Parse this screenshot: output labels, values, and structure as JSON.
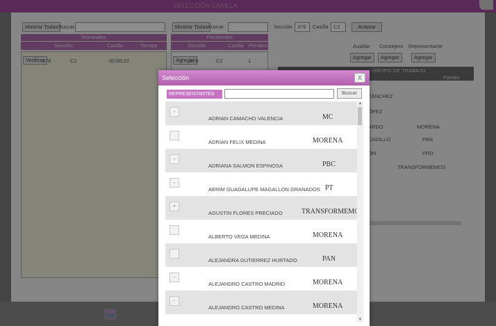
{
  "top": {
    "title": "SELECCIÓN CASILLA"
  },
  "left_panel": {
    "show_all": "Mostrar Todas",
    "search_label": "Buscar",
    "header": "Nominales",
    "columns": [
      "Sección",
      "Casilla",
      "Tiempo"
    ],
    "row": {
      "action": "Verificar",
      "seccion": "376",
      "casilla": "C2",
      "tiempo": "00:00:22"
    }
  },
  "mid_panel": {
    "show_all": "Mostrar Todas",
    "search_label": "Buscar",
    "header": "Pendientes",
    "columns": [
      "Sección",
      "Casilla",
      "Pendiente"
    ],
    "row": {
      "action": "Agregar",
      "seccion": "376",
      "casilla": "C2",
      "value": "1"
    }
  },
  "right_panel": {
    "seccion_label": "Sección",
    "seccion_value": "376",
    "casilla_label": "Casilla",
    "casilla_value": "C2",
    "accept": "Aceptar",
    "role_labels": [
      "Auxiliar",
      "Consejero",
      "Representante"
    ],
    "add_buttons": [
      "Agregar",
      "Agregar",
      "Agregar"
    ],
    "group_header": "GRUPO DE TRABAJO",
    "party_col": "Partido",
    "rows": [
      {
        "name": "ZÁNCHEZ",
        "party": ""
      },
      {
        "name": "ÓPEZ",
        "party": ""
      },
      {
        "name": "ARDO",
        "party": "MORENA"
      },
      {
        "name": "CADILLO",
        "party": "PAN"
      },
      {
        "name": "ÓN",
        "party": "PRD"
      },
      {
        "name": "",
        "party": "TRANSFORMEMOS"
      }
    ]
  },
  "modal": {
    "title": "Selección",
    "close": "X",
    "filter_label": "REPRESENTANTES",
    "filter_value": "",
    "search_button": "Buscar",
    "items": [
      {
        "mark": "-",
        "name": "ADRIAN CAMACHO VALENCIA",
        "party": "MC"
      },
      {
        "mark": "",
        "name": "ADRIAN FELIX MEDINA",
        "party": "MORENA"
      },
      {
        "mark": "-",
        "name": "ADRIANA SALMON ESPINOSA",
        "party": "PBC"
      },
      {
        "mark": "-",
        "name": "AERIM GUADALUPE MAGALLON GRANADOS",
        "party": "PT"
      },
      {
        "mark": "•",
        "name": "AGUSTIN FLORES PRECIADO",
        "party": "TRANSFORMEMOS"
      },
      {
        "mark": "",
        "name": "ALBERTO VEGA MEDINA",
        "party": "MORENA"
      },
      {
        "mark": "",
        "name": "ALEJANDRA GUTIERREZ HURTADO",
        "party": "PAN"
      },
      {
        "mark": "-",
        "name": "ALEJANDRO CASTRO MADRID",
        "party": "MORENA"
      },
      {
        "mark": "-",
        "name": "ALEJANDRO CASTRO MEDINA",
        "party": "MORENA"
      }
    ]
  },
  "colors": {
    "header": "#b15fae",
    "band": "#b16db0",
    "topbar": "#a34ba0"
  }
}
